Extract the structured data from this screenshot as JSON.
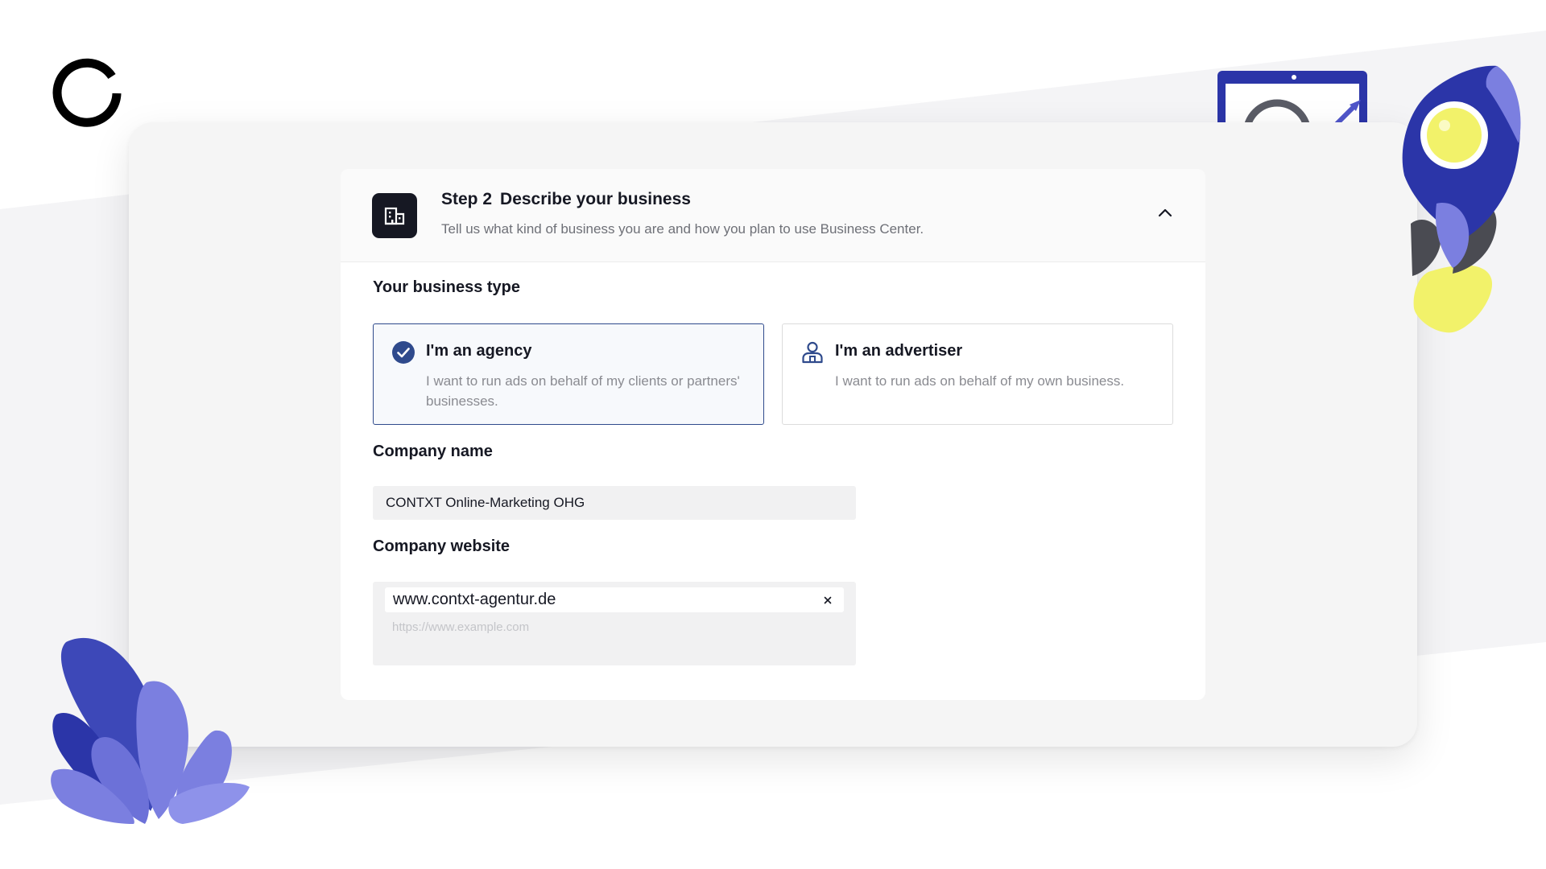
{
  "brand": {
    "logo_icon": "c-ring-logo-icon",
    "logo_color": "#000000"
  },
  "step": {
    "number": "Step 2",
    "title": "Describe your business",
    "subtitle": "Tell us what kind of business you are and how you plan to use Business Center.",
    "icon": "building-icon",
    "collapse_icon": "chevron-up-icon"
  },
  "business_type": {
    "label": "Your business type",
    "selected": "agency",
    "options": [
      {
        "id": "agency",
        "title": "I'm an agency",
        "description": "I want to run ads on behalf of my clients or partners' businesses.",
        "icon": "check-circle-icon"
      },
      {
        "id": "advertiser",
        "title": "I'm an advertiser",
        "description": "I want to run ads on behalf of my own business.",
        "icon": "user-icon"
      }
    ]
  },
  "company_name": {
    "label": "Company name",
    "value": "CONTXT Online-Marketing OHG"
  },
  "company_website": {
    "label": "Company website",
    "tags": [
      "www.contxt-agentur.de"
    ],
    "placeholder": "https://www.example.com",
    "clear_icon": "close-icon"
  },
  "colors": {
    "accent": "#2f4a8c",
    "text_primary": "#161823",
    "text_secondary": "#8a8b91",
    "panel_bg": "#f5f5f5",
    "input_bg": "#f1f1f2",
    "illustration_blue": "#2b35a8",
    "illustration_purple": "#7b7fe0",
    "illustration_yellow": "#f2f26a"
  }
}
